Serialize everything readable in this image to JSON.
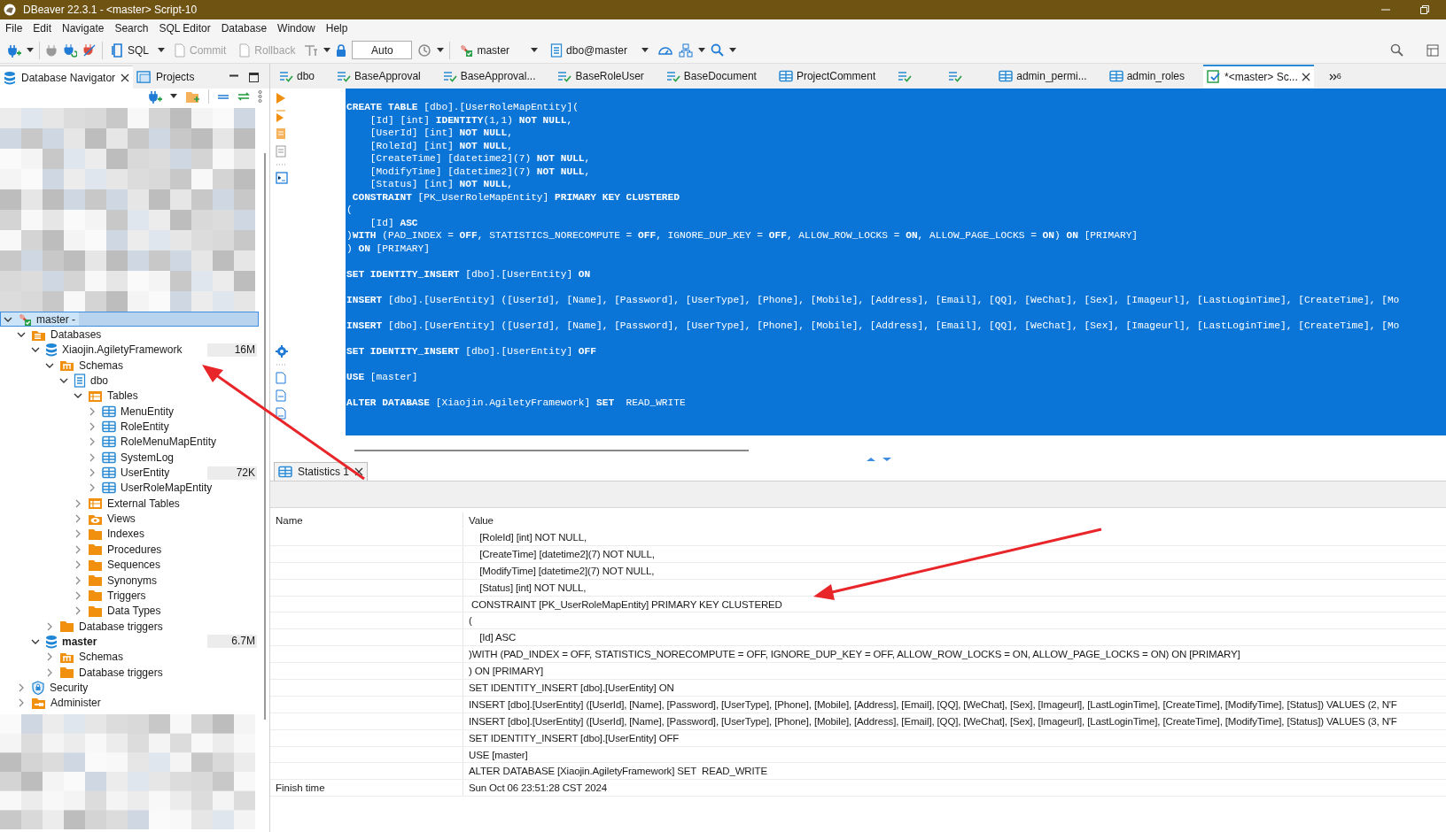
{
  "window": {
    "title": "DBeaver 22.3.1 - <master> Script-10"
  },
  "menu": [
    "File",
    "Edit",
    "Navigate",
    "Search",
    "SQL Editor",
    "Database",
    "Window",
    "Help"
  ],
  "toolbar": {
    "sql": "SQL",
    "commit": {
      "label": "Commit",
      "disabled": true
    },
    "rollback": {
      "label": "Rollback",
      "disabled": true
    },
    "transaction_mode": "Auto",
    "datasource": "master",
    "schema": "dbo@master"
  },
  "navigator_tabs": [
    {
      "label": "Database Navigator",
      "selected": true
    },
    {
      "label": "Projects",
      "selected": false
    }
  ],
  "tree": [
    {
      "label": "master -",
      "kind": "connection",
      "expanded": true,
      "selected": true,
      "children": [
        {
          "label": "Databases",
          "kind": "databases",
          "expanded": true,
          "selected": false,
          "children": [
            {
              "label": "Xiaojin.AgiletyFramework",
              "kind": "database",
              "size": "16M",
              "active": false,
              "expanded": true,
              "selected": false,
              "children": [
                {
                  "label": "Schemas",
                  "kind": "schemas",
                  "expanded": true,
                  "selected": false,
                  "children": [
                    {
                      "label": "dbo",
                      "kind": "schema",
                      "expanded": true,
                      "selected": false,
                      "children": [
                        {
                          "label": "Tables",
                          "kind": "tables",
                          "expanded": true,
                          "selected": false,
                          "children": [
                            {
                              "label": "MenuEntity",
                              "kind": "table",
                              "expanded": false,
                              "selected": false
                            },
                            {
                              "label": "RoleEntity",
                              "kind": "table",
                              "expanded": false,
                              "selected": false
                            },
                            {
                              "label": "RoleMenuMapEntity",
                              "kind": "table",
                              "expanded": false,
                              "selected": false
                            },
                            {
                              "label": "SystemLog",
                              "kind": "table",
                              "expanded": false,
                              "selected": false
                            },
                            {
                              "label": "UserEntity",
                              "kind": "table",
                              "size": "72K",
                              "expanded": false,
                              "selected": false
                            },
                            {
                              "label": "UserRoleMapEntity",
                              "kind": "table",
                              "expanded": false,
                              "selected": false
                            }
                          ]
                        },
                        {
                          "label": "External Tables",
                          "kind": "tables",
                          "expanded": false,
                          "selected": false
                        },
                        {
                          "label": "Views",
                          "kind": "views",
                          "expanded": false,
                          "selected": false
                        },
                        {
                          "label": "Indexes",
                          "kind": "folder",
                          "expanded": false,
                          "selected": false
                        },
                        {
                          "label": "Procedures",
                          "kind": "folder",
                          "expanded": false,
                          "selected": false
                        },
                        {
                          "label": "Sequences",
                          "kind": "folder",
                          "expanded": false,
                          "selected": false
                        },
                        {
                          "label": "Synonyms",
                          "kind": "folder",
                          "expanded": false,
                          "selected": false
                        },
                        {
                          "label": "Triggers",
                          "kind": "folder",
                          "expanded": false,
                          "selected": false
                        },
                        {
                          "label": "Data Types",
                          "kind": "folder",
                          "expanded": false,
                          "selected": false
                        }
                      ]
                    }
                  ]
                },
                {
                  "label": "Database triggers",
                  "kind": "folder",
                  "expanded": false,
                  "selected": false
                }
              ]
            },
            {
              "label": "master",
              "kind": "database",
              "size": "6.7M",
              "active": true,
              "expanded": true,
              "selected": false,
              "children": [
                {
                  "label": "Schemas",
                  "kind": "schemas",
                  "expanded": false,
                  "selected": false
                },
                {
                  "label": "Database triggers",
                  "kind": "folder",
                  "expanded": false,
                  "selected": false
                }
              ]
            }
          ]
        },
        {
          "label": "Security",
          "kind": "security",
          "expanded": false,
          "selected": false
        },
        {
          "label": "Administer",
          "kind": "administer",
          "expanded": false,
          "selected": false
        }
      ]
    }
  ],
  "editor_tabs": [
    {
      "label": "dbo",
      "kind": "script",
      "selected": false
    },
    {
      "label": "BaseApproval",
      "kind": "script",
      "selected": false
    },
    {
      "label": "BaseApproval...",
      "kind": "script",
      "selected": false
    },
    {
      "label": "BaseRoleUser",
      "kind": "script",
      "selected": false
    },
    {
      "label": "BaseDocument",
      "kind": "script",
      "selected": false
    },
    {
      "label": "ProjectComment",
      "kind": "table",
      "selected": false
    },
    {
      "kind": "script",
      "selected": false
    },
    {
      "kind": "script",
      "selected": false
    },
    {
      "label": "admin_permi...",
      "kind": "table",
      "selected": false
    },
    {
      "label": "admin_roles",
      "kind": "table",
      "selected": false
    },
    {
      "label": "*<master> Sc...",
      "kind": "console",
      "selected": true
    }
  ],
  "tab_overflow": "6",
  "editor": {
    "blocks": [
      [
        "**CREATE TABLE** [dbo].[UserRoleMapEntity](",
        "    [Id] [int] **IDENTITY**(1,1) **NOT NULL**,",
        "    [UserId] [int] **NOT NULL**,",
        "    [RoleId] [int] **NOT NULL**,",
        "    [CreateTime] [datetime2](7) **NOT NULL**,",
        "    [ModifyTime] [datetime2](7) **NOT NULL**,",
        "    [Status] [int] **NOT NULL**,",
        " **CONSTRAINT** [PK_UserRoleMapEntity] **PRIMARY KEY CLUSTERED**",
        "(",
        "    [Id] **ASC**",
        ")**WITH** (PAD_INDEX = **OFF**, STATISTICS_NORECOMPUTE = **OFF**, IGNORE_DUP_KEY = **OFF**, ALLOW_ROW_LOCKS = **ON**, ALLOW_PAGE_LOCKS = **ON**) **ON** [PRIMARY]",
        ") **ON** [PRIMARY]"
      ],
      [
        "**SET IDENTITY_INSERT** [dbo].[UserEntity] **ON**"
      ],
      [
        "**INSERT** [dbo].[UserEntity] ([UserId], [Name], [Password], [UserType], [Phone], [Mobile], [Address], [Email], [QQ], [WeChat], [Sex], [Imageurl], [LastLoginTime], [CreateTime], [Mo"
      ],
      [
        "**INSERT** [dbo].[UserEntity] ([UserId], [Name], [Password], [UserType], [Phone], [Mobile], [Address], [Email], [QQ], [WeChat], [Sex], [Imageurl], [LastLoginTime], [CreateTime], [Mo"
      ],
      [
        "**SET IDENTITY_INSERT** [dbo].[UserEntity] **OFF**"
      ],
      [
        "**USE** [master]"
      ],
      [
        "**ALTER DATABASE** [Xiaojin.AgiletyFramework] **SET**  READ_WRITE"
      ]
    ]
  },
  "results": {
    "tabs": [
      {
        "label": "Statistics 1",
        "selected": true
      }
    ],
    "columns": [
      "Name",
      "Value"
    ],
    "rows": [
      {
        "value": "    [RoleId] [int] NOT NULL,"
      },
      {
        "value": "    [CreateTime] [datetime2](7) NOT NULL,"
      },
      {
        "value": "    [ModifyTime] [datetime2](7) NOT NULL,"
      },
      {
        "value": "    [Status] [int] NOT NULL,"
      },
      {
        "value": " CONSTRAINT [PK_UserRoleMapEntity] PRIMARY KEY CLUSTERED"
      },
      {
        "value": "("
      },
      {
        "value": "    [Id] ASC"
      },
      {
        "value": ")WITH (PAD_INDEX = OFF, STATISTICS_NORECOMPUTE = OFF, IGNORE_DUP_KEY = OFF, ALLOW_ROW_LOCKS = ON, ALLOW_PAGE_LOCKS = ON) ON [PRIMARY]"
      },
      {
        "value": ") ON [PRIMARY]"
      },
      {
        "value": "SET IDENTITY_INSERT [dbo].[UserEntity] ON"
      },
      {
        "value": "INSERT [dbo].[UserEntity] ([UserId], [Name], [Password], [UserType], [Phone], [Mobile], [Address], [Email], [QQ], [WeChat], [Sex], [Imageurl], [LastLoginTime], [CreateTime], [ModifyTime], [Status]) VALUES (2, N'F"
      },
      {
        "value": "INSERT [dbo].[UserEntity] ([UserId], [Name], [Password], [UserType], [Phone], [Mobile], [Address], [Email], [QQ], [WeChat], [Sex], [Imageurl], [LastLoginTime], [CreateTime], [ModifyTime], [Status]) VALUES (3, N'F"
      },
      {
        "value": "SET IDENTITY_INSERT [dbo].[UserEntity] OFF"
      },
      {
        "value": "USE [master]"
      },
      {
        "value": "ALTER DATABASE [Xiaojin.AgiletyFramework] SET  READ_WRITE"
      },
      {
        "name": "Finish time",
        "value": "Sun Oct 06 23:51:28 CST 2024"
      }
    ]
  }
}
